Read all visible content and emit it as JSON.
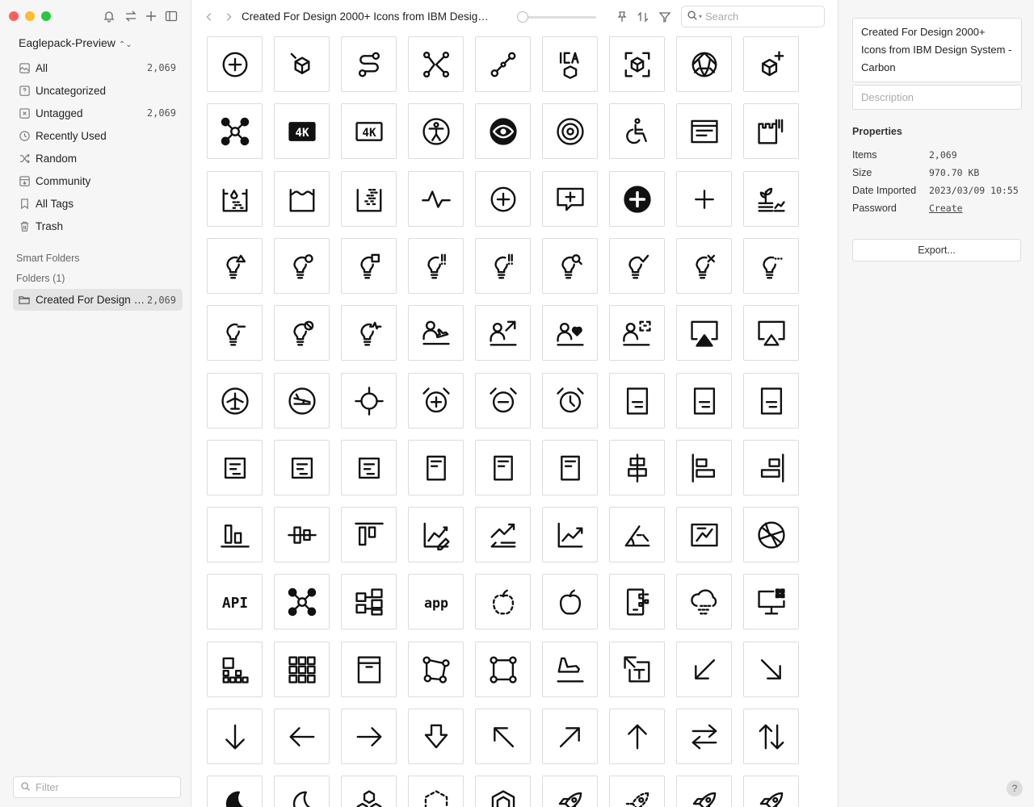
{
  "sidebar": {
    "library_name": "Eaglepack-Preview",
    "items": [
      {
        "label": "All",
        "count": "2,069",
        "icon": "image-box-icon"
      },
      {
        "label": "Uncategorized",
        "count": "",
        "icon": "question-box-icon"
      },
      {
        "label": "Untagged",
        "count": "2,069",
        "icon": "tag-x-icon"
      },
      {
        "label": "Recently Used",
        "count": "",
        "icon": "clock-icon"
      },
      {
        "label": "Random",
        "count": "",
        "icon": "shuffle-icon"
      },
      {
        "label": "Community",
        "count": "",
        "icon": "download-box-icon"
      },
      {
        "label": "All Tags",
        "count": "",
        "icon": "bookmark-icon"
      },
      {
        "label": "Trash",
        "count": "",
        "icon": "trash-icon"
      }
    ],
    "smart_folders_label": "Smart Folders",
    "folders_label": "Folders (1)",
    "folder": {
      "label": "Created For Design 2000+ Icons from IBM Design System - Carbon",
      "count": "2,069"
    },
    "filter_placeholder": "Filter"
  },
  "toolbar": {
    "title": "Created For Design 2000+ Icons from IBM Design System - Carbon",
    "search_placeholder": "Search",
    "zoom_level": 0.05
  },
  "grid": {
    "icons": [
      "add-circle-icon",
      "cube-view-icon",
      "route-icon",
      "network-icon",
      "connection-icon",
      "ica-3d-icon",
      "cube-scan-icon",
      "polygon-sphere-icon",
      "cube-add-icon",
      "network-x-icon",
      "4k-filled-icon",
      "4k-icon",
      "accessibility-icon",
      "eye-filled-icon",
      "target-icon",
      "wheelchair-icon",
      "window-text-icon",
      "building-bars-icon",
      "water-grid-icon",
      "water-tank-icon",
      "tank-dots-icon",
      "activity-icon",
      "add-circle-icon",
      "chat-add-icon",
      "add-filled-icon",
      "add-icon",
      "plant-chart-icon",
      "bulb-triangle-icon",
      "bulb-circle-icon",
      "bulb-square-icon",
      "bulb-exclaim-icon",
      "bulb-exclaim-icon",
      "bulb-search-icon",
      "bulb-check-icon",
      "bulb-x-icon",
      "bulb-dots-icon",
      "bulb-dash-icon",
      "bulb-blocked-icon",
      "bulb-pulse-icon",
      "user-plane-icon",
      "user-arrow-icon",
      "user-heart-icon",
      "user-scan-icon",
      "airplay-filled-icon",
      "airplay-icon",
      "plane-circle-icon",
      "plane-landing-circle-icon",
      "crosshair-icon",
      "alarm-add-icon",
      "alarm-minus-icon",
      "alarm-icon",
      "document-text-icon",
      "document-text-icon",
      "document-text-icon",
      "align-box-icon",
      "align-box-icon",
      "align-box-icon",
      "document-icon",
      "document-icon",
      "document-icon",
      "align-center-icon",
      "align-left-icon",
      "align-right-icon",
      "align-bottom-icon",
      "align-middle-icon",
      "align-top-icon",
      "chart-edit-icon",
      "chart-trend-icon",
      "chart-line-icon",
      "angle-icon",
      "chart-window-icon",
      "aperture-icon",
      "api-text-icon",
      "network-x-icon",
      "app-connect-icon",
      "app-text-icon",
      "apple-dashed-icon",
      "apple-icon",
      "device-qr-icon",
      "cloud-grid-icon",
      "monitor-grid-icon",
      "apps-small-icon",
      "apps-grid-icon",
      "archive-icon",
      "shape-connect-icon",
      "shape-square-icon",
      "plane-takeoff-icon",
      "text-resize-icon",
      "arrow-down-left-icon",
      "arrow-down-right-icon",
      "arrow-down-icon",
      "arrow-left-icon",
      "arrow-right-icon",
      "arrow-down-box-icon",
      "arrow-up-left-icon",
      "arrow-up-right-icon",
      "arrow-up-icon",
      "arrows-horizontal-icon",
      "arrows-vertical-icon",
      "moon-filled-icon",
      "moon-icon",
      "hexagon-cluster-icon",
      "hexagon-dashed-icon",
      "hexagon-icon",
      "rocket-icon",
      "rocket-dashed-icon",
      "rocket-icon",
      "rocket-icon"
    ]
  },
  "inspector": {
    "title": "Created For Design 2000+ Icons from IBM Design System - Carbon",
    "description_placeholder": "Description",
    "properties_heading": "Properties",
    "properties": [
      {
        "key": "Items",
        "value": "2,069",
        "link": false
      },
      {
        "key": "Size",
        "value": "970.70 KB",
        "link": false
      },
      {
        "key": "Date Imported",
        "value": "2023/03/09 10:55",
        "link": false
      },
      {
        "key": "Password",
        "value": "Create",
        "link": true
      }
    ],
    "export_label": "Export...",
    "help_label": "?"
  }
}
